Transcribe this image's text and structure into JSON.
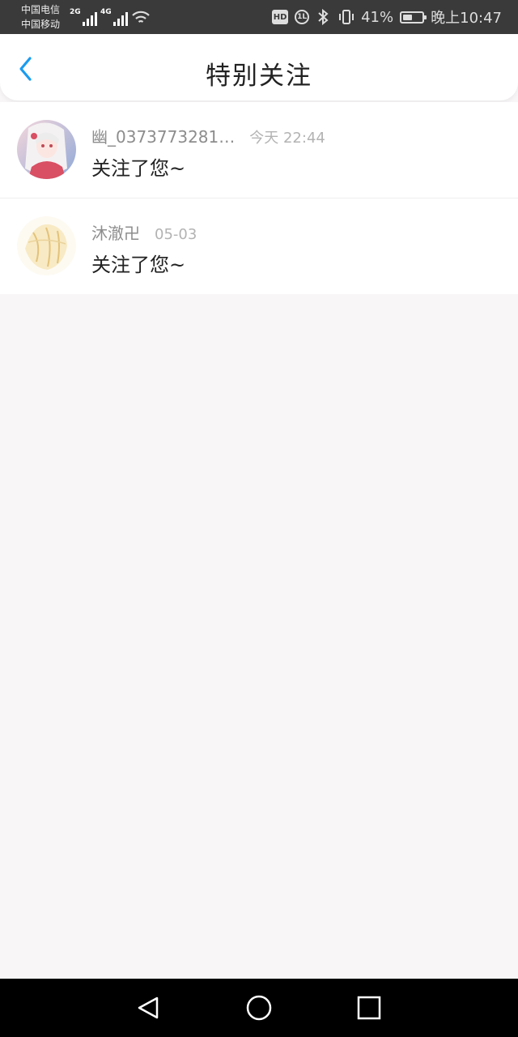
{
  "status_bar": {
    "carrier_1": "中国电信",
    "carrier_2": "中国移动",
    "network_1": "2G",
    "network_2": "4G",
    "hd_label": "HD",
    "data_badge": "1L",
    "battery_percent": "41%",
    "battery_level": 0.41,
    "time": "晚上10:47"
  },
  "header": {
    "title": "特别关注",
    "accent_color": "#1a9cf0"
  },
  "list": {
    "items": [
      {
        "name": "幽_0373773281…",
        "time": "今天 22:44",
        "message": "关注了您~",
        "avatar_icon": "avatar-anime-girl-icon"
      },
      {
        "name": "沐澈卍",
        "time": "05-03",
        "message": "关注了您~",
        "avatar_icon": "avatar-sketch-icon"
      }
    ]
  },
  "nav": {
    "back_icon": "triangle-back-icon",
    "home_icon": "circle-home-icon",
    "recent_icon": "square-recent-icon"
  }
}
